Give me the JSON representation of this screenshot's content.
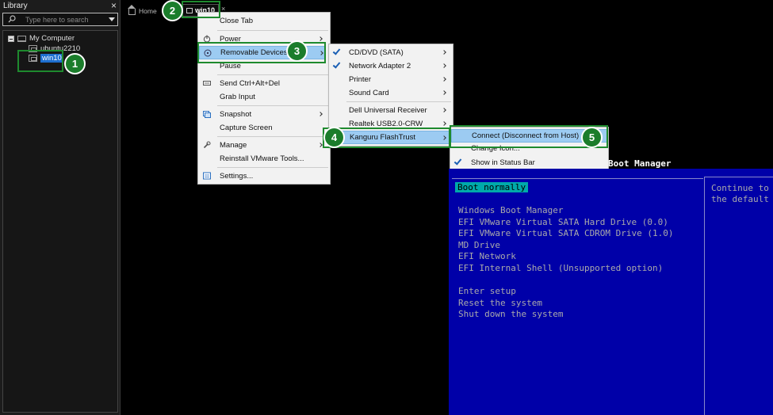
{
  "library": {
    "title": "Library",
    "close": "×",
    "search_placeholder": "Type here to search",
    "tree": {
      "root": "My Computer",
      "items": [
        "ubuntu2210",
        "win10"
      ]
    }
  },
  "tabs": {
    "home": "Home",
    "active": "win10",
    "close": "×"
  },
  "main_menu": {
    "items": [
      {
        "label": "Close Tab"
      },
      {
        "label": "Power"
      },
      {
        "label": "Removable Devices"
      },
      {
        "label": "Pause"
      },
      {
        "label": "Send Ctrl+Alt+Del"
      },
      {
        "label": "Grab Input"
      },
      {
        "label": "Snapshot"
      },
      {
        "label": "Capture Screen"
      },
      {
        "label": "Manage"
      },
      {
        "label": "Reinstall VMware Tools..."
      },
      {
        "label": "Settings..."
      }
    ]
  },
  "devices_menu": {
    "items": [
      {
        "label": "CD/DVD (SATA)"
      },
      {
        "label": "Network Adapter 2"
      },
      {
        "label": "Printer"
      },
      {
        "label": "Sound Card"
      },
      {
        "label": "Dell Universal Receiver"
      },
      {
        "label": "Realtek USB2.0-CRW"
      },
      {
        "label": "Kanguru FlashTrust"
      }
    ]
  },
  "kanguru_menu": {
    "items": [
      {
        "label": "Connect (Disconnect from Host)"
      },
      {
        "label": "Change Icon..."
      },
      {
        "label": "Show in Status Bar"
      }
    ]
  },
  "callouts": [
    "1",
    "2",
    "3",
    "4",
    "5"
  ],
  "boot": {
    "title": "Boot Manager",
    "selected": "Boot normally",
    "entries": [
      "Windows Boot Manager",
      "EFI VMware Virtual SATA Hard Drive (0.0)",
      "EFI VMware Virtual SATA CDROM Drive (1.0)",
      "MD Drive",
      "EFI Network",
      "EFI Internal Shell (Unsupported option)"
    ],
    "actions": [
      "Enter setup",
      "Reset the system",
      "Shut down the system"
    ],
    "help": [
      "Continue to b",
      "the default b"
    ]
  },
  "colors": {
    "accent_green": "#1e8a2e",
    "highlight_blue": "#9ccbf2",
    "bios_blue": "#0000a8",
    "bios_cyan": "#00aaaa"
  }
}
